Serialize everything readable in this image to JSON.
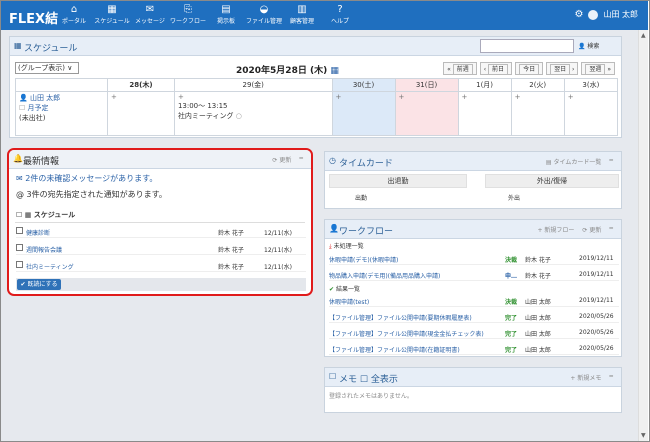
{
  "app": {
    "logo": "FLEX結"
  },
  "nav": [
    {
      "icon": "home-icon",
      "glyph": "⌂",
      "label": "ポータル"
    },
    {
      "icon": "calendar-icon",
      "glyph": "▦",
      "label": "スケジュール"
    },
    {
      "icon": "mail-icon",
      "glyph": "✉",
      "label": "メッセージ"
    },
    {
      "icon": "workflow-icon",
      "glyph": "⎘",
      "label": "ワークフロー"
    },
    {
      "icon": "board-icon",
      "glyph": "▤",
      "label": "掲示板"
    },
    {
      "icon": "folder-icon",
      "glyph": "◒",
      "label": "ファイル管理"
    },
    {
      "icon": "customer-icon",
      "glyph": "▥",
      "label": "顧客管理"
    },
    {
      "icon": "help-icon",
      "glyph": "?",
      "label": "ヘルプ"
    }
  ],
  "user": {
    "name": "山田 太郎"
  },
  "schedule": {
    "title": "スケジュール",
    "search_label": "検索",
    "group_select": "(グループ表示)",
    "date_title": "2020年5月28日 (木)",
    "nav_buttons": [
      "前週",
      "前日",
      "今日",
      "翌日",
      "翌週"
    ],
    "days": [
      "28(木)",
      "29(金)",
      "30(土)",
      "31(日)",
      "1(月)",
      "2(火)",
      "3(水)"
    ],
    "row_user": "山田 太郎",
    "row_plan": "月予定",
    "row_status": "(未出社)",
    "event_time": "13:00～ 13:15",
    "event_title": "社内ミーティング"
  },
  "news": {
    "title": "最新情報",
    "refresh": "更新",
    "unread_msg": "2件の未確認メッセージがあります。",
    "notice_msg": "3件の宛先指定された通知があります。",
    "section": "スケジュール",
    "rows": [
      {
        "title": "健康診断",
        "user": "鈴木 花子",
        "date": "12/11(水)"
      },
      {
        "title": "週間報告会議",
        "user": "鈴木 花子",
        "date": "12/11(水)"
      },
      {
        "title": "社内ミーティング",
        "user": "鈴木 花子",
        "date": "12/11(水)"
      }
    ],
    "read_button": "既読にする"
  },
  "timecard": {
    "title": "タイムカード",
    "list": "タイムカード一覧",
    "clock_in": "出退勤",
    "out_return": "外出/復帰",
    "in_status": "出勤",
    "out_status": "外出"
  },
  "workflow": {
    "title": "ワークフロー",
    "new_flow": "新規フロー",
    "refresh": "更新",
    "pending": "未処理一覧",
    "done": "結果一覧",
    "pending_rows": [
      {
        "title": "休暇申請(デモ)(休暇申請)",
        "status": "決裁",
        "user": "鈴木 花子",
        "date": "2019/12/11"
      },
      {
        "title": "物品購入申請(デモ用)(備品用品購入申請)",
        "status": "申…",
        "user": "鈴木 花子",
        "date": "2019/12/11"
      }
    ],
    "done_rows": [
      {
        "title": "休暇申請(test)",
        "status": "決裁",
        "user": "山田 太郎",
        "date": "2019/12/11"
      },
      {
        "title": "【ファイル管理】ファイル公開申請(要期休暇履歴表)",
        "status": "完了",
        "user": "山田 太郎",
        "date": "2020/05/26"
      },
      {
        "title": "【ファイル管理】ファイル公開申請(現金金払チェック表)",
        "status": "完了",
        "user": "山田 太郎",
        "date": "2020/05/26"
      },
      {
        "title": "【ファイル管理】ファイル公開申請(在籍証明書)",
        "status": "完了",
        "user": "山田 太郎",
        "date": "2020/05/26"
      }
    ]
  },
  "memo": {
    "title": "メモ",
    "show_all": "全表示",
    "new_memo": "新規メモ",
    "empty": "登録されたメモはありません。"
  }
}
